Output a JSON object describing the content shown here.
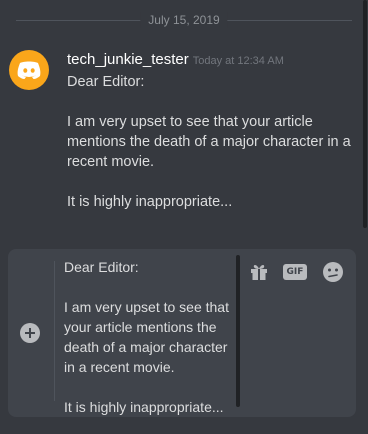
{
  "date_divider": {
    "label": "July 15, 2019"
  },
  "message": {
    "username": "tech_junkie_tester",
    "timestamp": "Today at 12:34 AM",
    "avatar_color": "#faa61a",
    "avatar_icon": "discord-logo-icon",
    "lines": [
      "Dear Editor:",
      "",
      "I am very upset to see that your article mentions the death of a major character in a recent movie.",
      "",
      "It is highly inappropriate..."
    ]
  },
  "composer": {
    "attach_icon": "plus-circle-icon",
    "lines": [
      "Dear Editor:",
      "",
      "I am very upset to see that your article mentions the death of a major character in a recent movie.",
      "",
      "It is highly inappropriate..."
    ],
    "buttons": {
      "gift_icon": "gift-icon",
      "gif_label": "GIF",
      "emoji_icon": "emoji-icon"
    }
  },
  "colors": {
    "background": "#36393f",
    "composer_bg": "#40444b",
    "username": "#ffffff",
    "text": "#dcddde",
    "muted": "#72767d"
  }
}
